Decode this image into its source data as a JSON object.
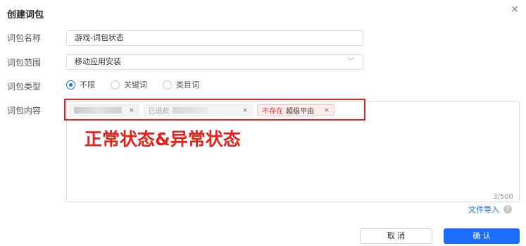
{
  "dialog": {
    "title": "创建词包",
    "close_icon": "close-icon"
  },
  "form": {
    "name_label": "词包名称",
    "name_value": "游戏-词包状态",
    "range_label": "词包范围",
    "range_value": "移动应用安装",
    "type_label": "词包类型",
    "type_options": [
      "不限",
      "关键词",
      "类目词"
    ],
    "type_selected": "不限",
    "content_label": "词包内容"
  },
  "tags": {
    "tag2_text": "已退款",
    "tag3_warn": "不存在",
    "tag3_word": "超级平由",
    "remove_glyph": "×"
  },
  "annotation": {
    "text": "正常状态&异常状态"
  },
  "counter": "3/500",
  "import_label": "文件导入",
  "buttons": {
    "cancel": "取 消",
    "confirm": "确 认"
  },
  "colors": {
    "accent": "#1a6dff",
    "highlight": "#e3221c"
  }
}
